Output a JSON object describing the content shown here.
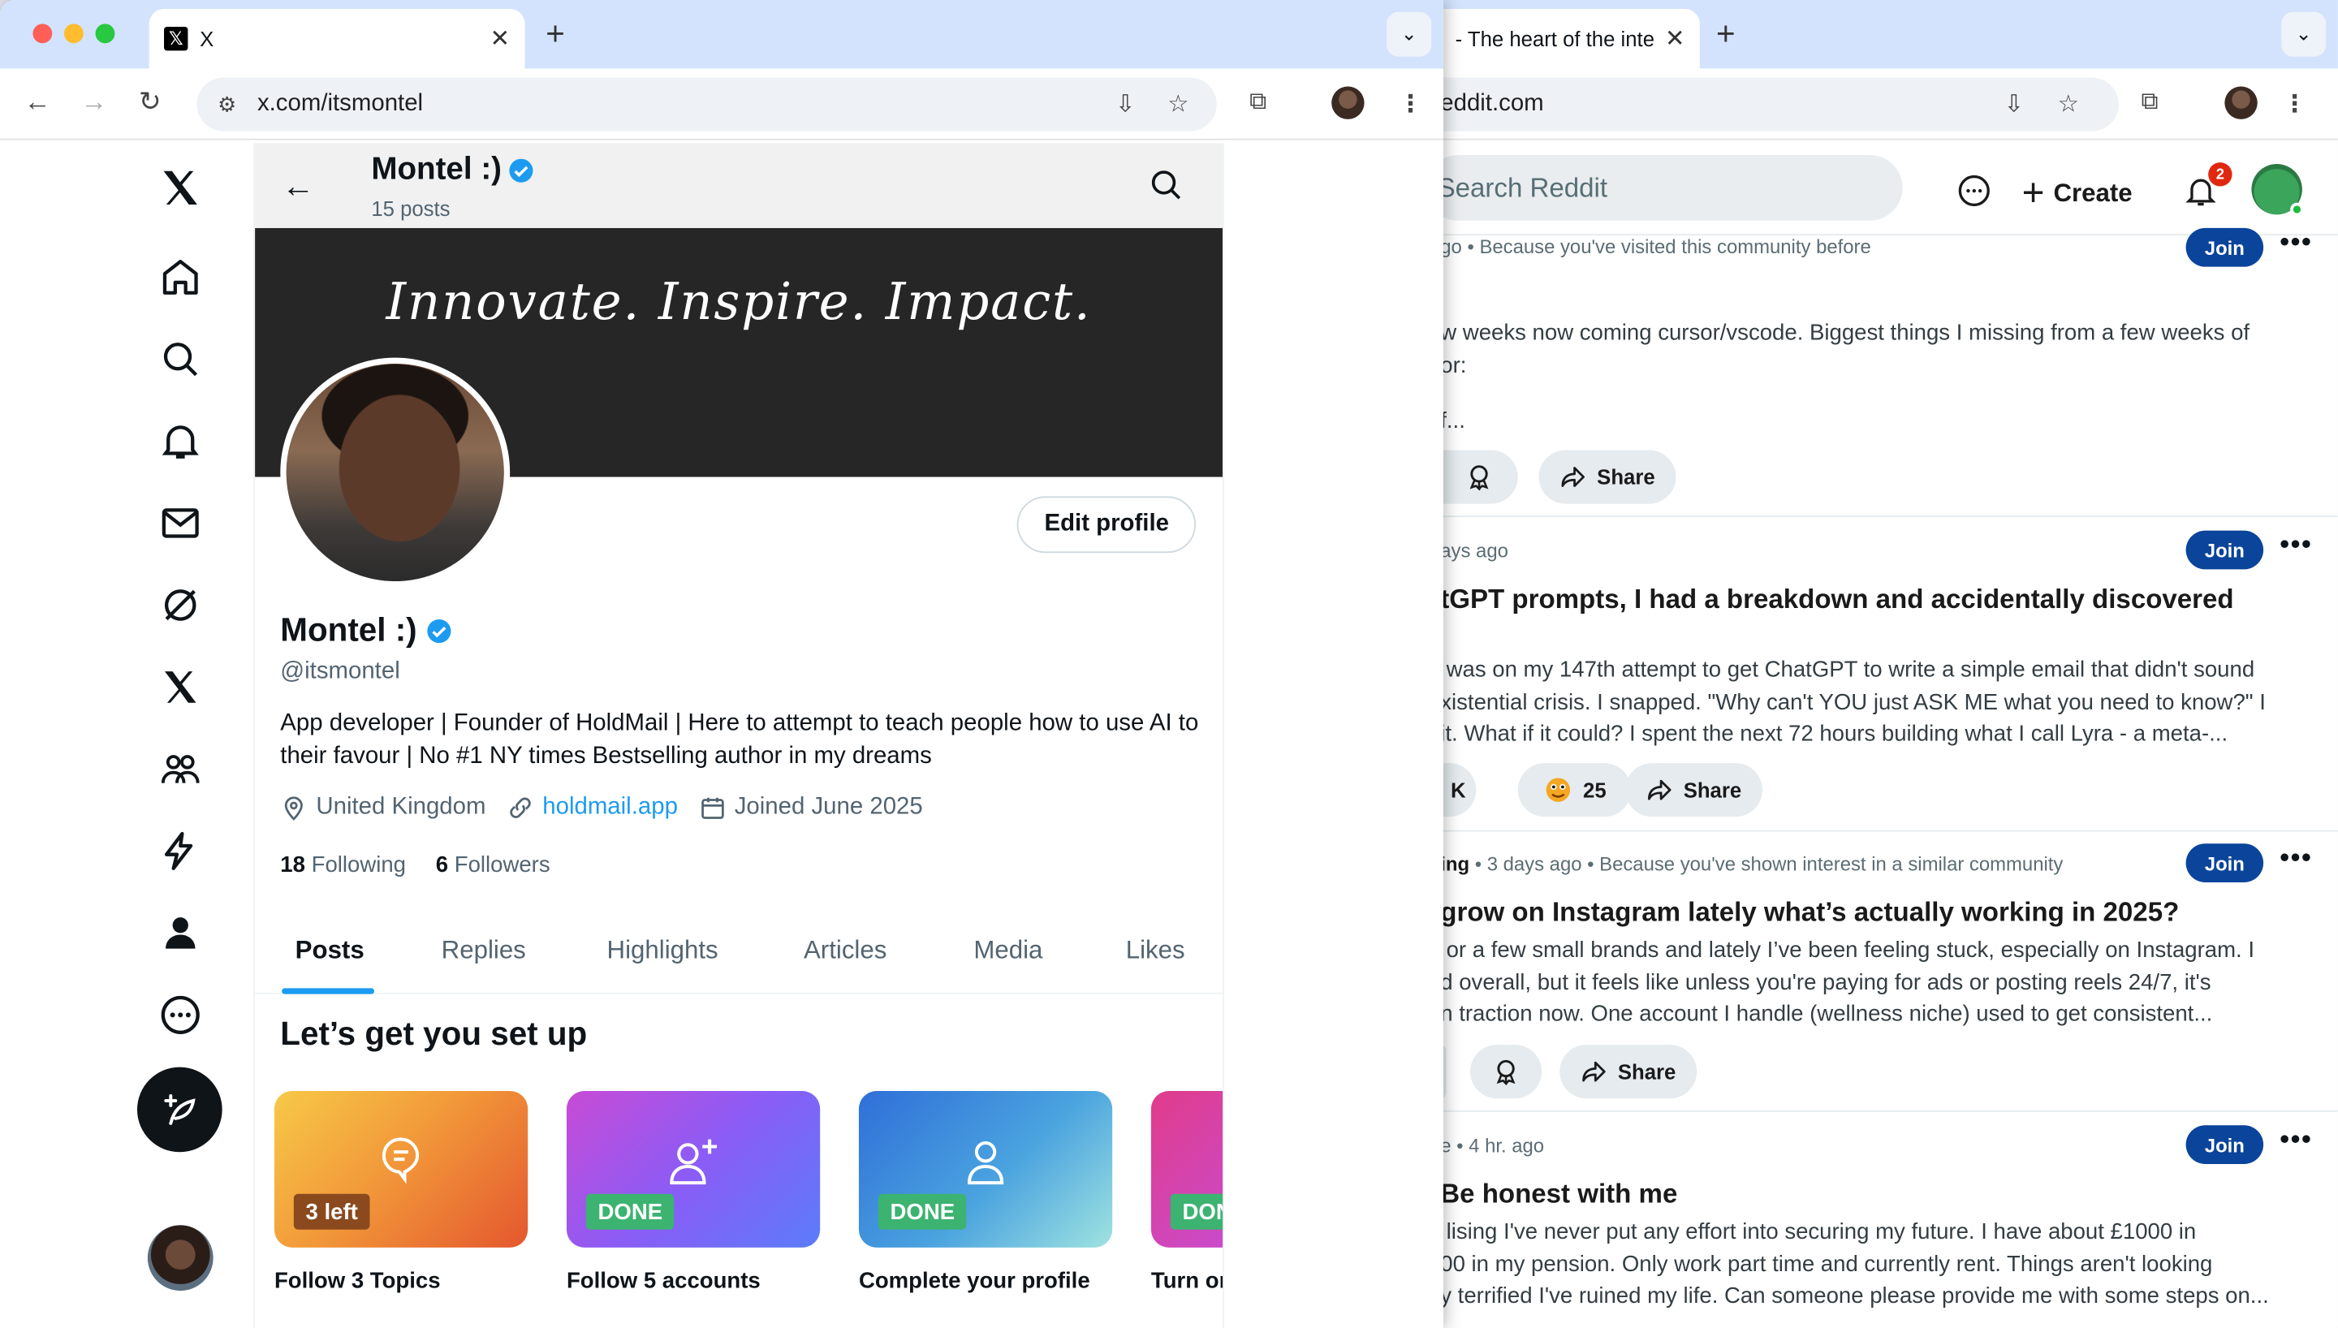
{
  "x_window": {
    "tab_title": "X",
    "url": "x.com/itsmontel",
    "header": {
      "name": "Montel :)",
      "post_count": "15 posts"
    },
    "banner_text": "Innovate. Inspire. Impact.",
    "profile": {
      "name": "Montel :)",
      "handle": "@itsmontel",
      "bio": "App developer | Founder of HoldMail | Here to attempt to teach people how to use AI to their favour | No #1 NY times Bestselling author in my dreams",
      "location": "United Kingdom",
      "website": "holdmail.app",
      "joined": "Joined June 2025",
      "following_count": "18",
      "following_label": "Following",
      "followers_count": "6",
      "followers_label": "Followers",
      "edit_label": "Edit profile"
    },
    "tabs": [
      "Posts",
      "Replies",
      "Highlights",
      "Articles",
      "Media",
      "Likes"
    ],
    "setup": {
      "title": "Let’s get you set up",
      "cards": [
        {
          "badge": "3 left",
          "label": "Follow 3 Topics"
        },
        {
          "badge": "DONE",
          "label": "Follow 5 accounts"
        },
        {
          "badge": "DONE",
          "label": "Complete your profile"
        },
        {
          "badge": "DON",
          "label": "Turn on"
        }
      ]
    }
  },
  "reddit_window": {
    "tab_title": "- The heart of the inte",
    "url": "eddit.com",
    "search_placeholder": "Search Reddit",
    "create_label": "Create",
    "notif_count": "2",
    "join_label": "Join",
    "share_label": "Share",
    "posts": [
      {
        "meta": "go • Because you've visited this community before",
        "body_lines": [
          "w weeks now coming cursor/vscode. Biggest things I missing from a few weeks of",
          "or:",
          "",
          "f..."
        ]
      },
      {
        "meta": "ays ago",
        "title": "tGPT prompts, I had a breakdown and accidentally discovered",
        "body_lines": [
          "was on my 147th attempt to get ChatGPT to write a simple email that didn't sound",
          "xistential crisis. I snapped. \"Why can't YOU just ASK ME what you need to know?\" I",
          "it. What if it could? I spent the next 72 hours building what I call Lyra - a meta-..."
        ],
        "votes": "K",
        "award_count": "25"
      },
      {
        "meta_bold": "ing",
        "meta": " • 3 days ago • Because you've shown interest in a similar community",
        "title": "grow on Instagram lately what’s actually working in 2025?",
        "body_lines": [
          "or a few small brands and lately I’ve been feeling stuck, especially on Instagram. I",
          "d overall, but it feels like unless you're paying for ads or posting reels 24/7, it's",
          "n traction now. One account I handle (wellness niche) used to get consistent..."
        ]
      },
      {
        "meta": "e • 4 hr. ago",
        "title": "Be honest with me",
        "body_lines": [
          "lising I've never put any effort into securing my future. I have about £1000 in",
          "00 in my pension. Only work part time and currently rent. Things aren't looking",
          "y terrified I've ruined my life. Can someone please provide me with some steps on..."
        ]
      }
    ]
  },
  "colors": {
    "x_blue": "#1d9bf0",
    "reddit_join": "#0a449b",
    "chrome_tabstrip": "#d3e3fd"
  }
}
